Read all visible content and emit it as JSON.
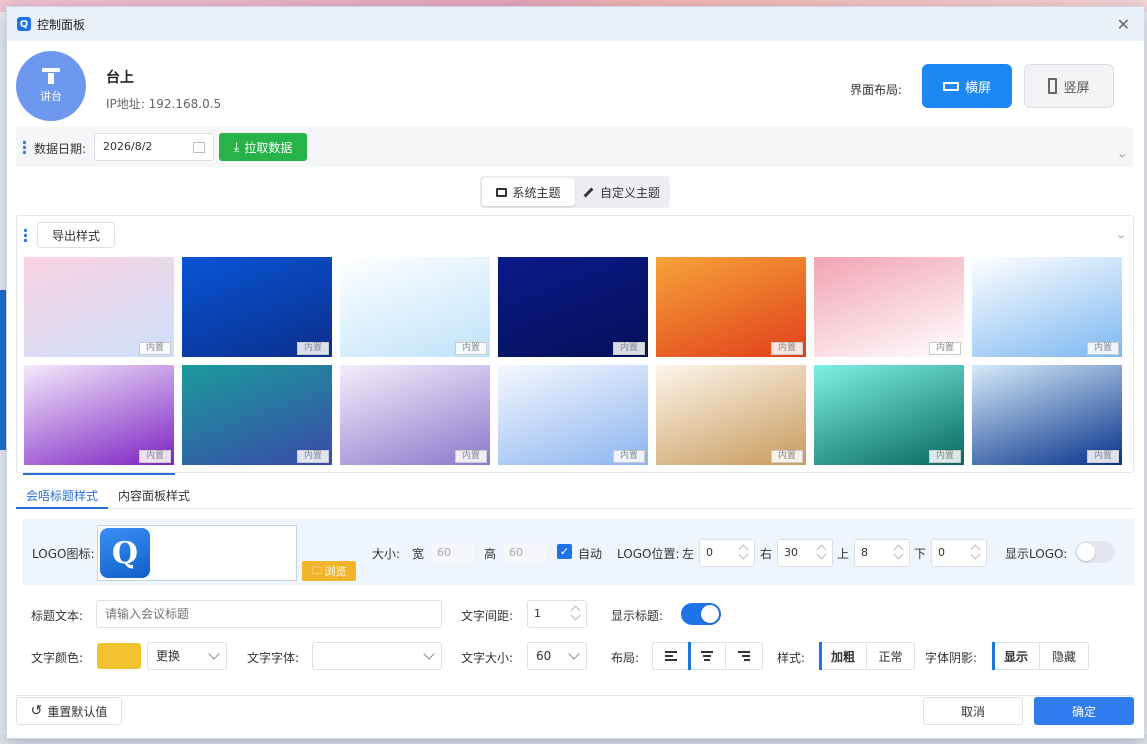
{
  "window": {
    "title": "控制面板",
    "app_icon": "Q"
  },
  "venue": {
    "avatar_label": "讲台",
    "name": "台上",
    "ip": "IP地址: 192.168.0.5"
  },
  "layout": {
    "label": "界面布局:",
    "horizontal": "横屏",
    "vertical": "竖屏",
    "selected": "横屏"
  },
  "date_bar": {
    "label": "数据日期:",
    "date": "2026/8/2",
    "fetch_button": "拉取数据"
  },
  "theme_tabs": {
    "system": "系统主题",
    "custom": "自定义主题",
    "active": "系统主题"
  },
  "gallery": {
    "export_button": "导出样式",
    "tag": "内置",
    "thumbnails": [
      {
        "id": "theme-1",
        "colors": [
          "#fbd3e2",
          "#cde0fb"
        ]
      },
      {
        "id": "theme-2",
        "colors": [
          "#0a54d6",
          "#0b2f8c"
        ]
      },
      {
        "id": "theme-3",
        "colors": [
          "#ffffff",
          "#bfe3fb"
        ]
      },
      {
        "id": "theme-4",
        "colors": [
          "#0a1a8a",
          "#051058"
        ]
      },
      {
        "id": "theme-5",
        "colors": [
          "#f7a33a",
          "#e0401a"
        ]
      },
      {
        "id": "theme-6",
        "colors": [
          "#f2a3b4",
          "#ffffff"
        ]
      },
      {
        "id": "theme-7",
        "colors": [
          "#ffffff",
          "#7cb8f2"
        ]
      },
      {
        "id": "theme-8",
        "colors": [
          "#f4eafc",
          "#7d22c2"
        ]
      },
      {
        "id": "theme-9",
        "colors": [
          "#1a9b9c",
          "#3a4aa8"
        ]
      },
      {
        "id": "theme-10",
        "colors": [
          "#f4eefb",
          "#8c78cc"
        ]
      },
      {
        "id": "theme-11",
        "colors": [
          "#f5f8ff",
          "#8cb5f0"
        ]
      },
      {
        "id": "theme-12",
        "colors": [
          "#fdf6ea",
          "#c99a5e"
        ]
      },
      {
        "id": "theme-13",
        "colors": [
          "#7ff2e4",
          "#05685e"
        ]
      },
      {
        "id": "theme-14",
        "colors": [
          "#d6ecfb",
          "#06328a"
        ]
      }
    ]
  },
  "style_tabs": {
    "title_style": "会唔标题样式",
    "panel_style": "内容面板样式",
    "active": "会唔标题样式"
  },
  "logo": {
    "label": "LOGO图标:",
    "glyph": "Q",
    "browse": "浏览",
    "size_label": "大小:",
    "width_label": "宽",
    "width": "60",
    "height_label": "高",
    "height": "60",
    "auto_label": "自动",
    "auto_checked": true,
    "position_label": "LOGO位置:",
    "left_label": "左",
    "left": "0",
    "right_label": "右",
    "right": "30",
    "top_label": "上",
    "top": "8",
    "bottom_label": "下",
    "bottom": "0",
    "show_label": "显示LOGO:",
    "show": false
  },
  "title_text": {
    "label": "标题文本:",
    "placeholder": "请输入会议标题",
    "spacing_label": "文字间距:",
    "spacing": "1",
    "show_label": "显示标题:",
    "show": true
  },
  "text_style": {
    "color_label": "文字颜色:",
    "color": "#f2c12e",
    "change_button": "更换",
    "font_label": "文字字体:",
    "font_value": "",
    "size_label": "文字大小:",
    "size": "60",
    "layout_label": "布局:",
    "align_options": [
      "left-align-icon",
      "center-align-icon",
      "right-align-icon"
    ],
    "align_selected": "center-align-icon",
    "style_label": "样式:",
    "bold": "加粗",
    "normal": "正常",
    "style_selected": "加粗",
    "shadow_label": "字体阴影:",
    "shadow_show": "显示",
    "shadow_hide": "隐藏",
    "shadow_selected": "显示"
  },
  "footer": {
    "reset": "重置默认值",
    "cancel": "取消",
    "confirm": "确定"
  }
}
